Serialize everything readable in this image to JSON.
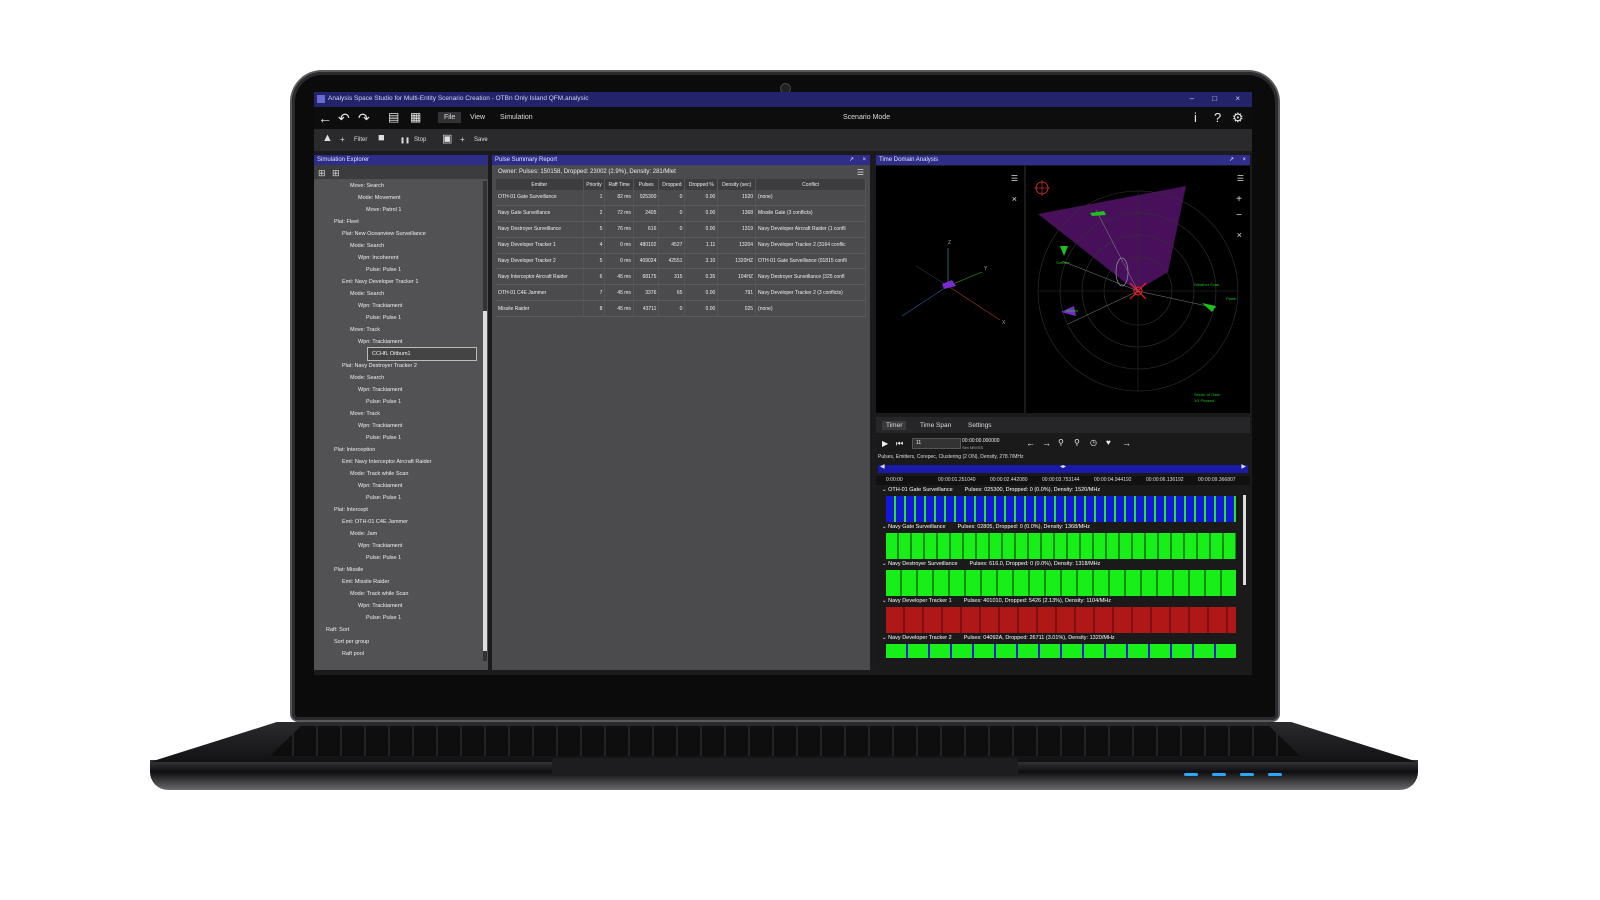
{
  "window": {
    "title": "Analysis Space Studio for Multi-Entity Scenario Creation - OTBn Only Island QFM.analysic",
    "controls": [
      "–",
      "□",
      "×"
    ]
  },
  "menubar": {
    "items": [
      {
        "label": "File",
        "active": true
      },
      {
        "label": "View",
        "active": false
      },
      {
        "label": "Simulation",
        "active": false
      }
    ],
    "mode": "Scenario Mode",
    "right_icons": [
      "info-icon",
      "help-icon",
      "gear-icon"
    ]
  },
  "toolbar": {
    "filter_label": "Filter",
    "stop_label": "Stop",
    "save_label": "Save"
  },
  "explorer": {
    "title": "Simulation Explorer",
    "nodes": [
      {
        "text": "Move:  Search",
        "indent": 4
      },
      {
        "text": "Mode:  Movement",
        "indent": 5
      },
      {
        "text": "Move:  Patrol 1",
        "indent": 6
      },
      {
        "text": "Plat:  Fleet",
        "indent": 2
      },
      {
        "text": "Plat:  New Oceanview Surveillance",
        "indent": 3
      },
      {
        "text": "Mode:  Search",
        "indent": 4
      },
      {
        "text": "Wpn:  Incoherent",
        "indent": 5
      },
      {
        "text": "Pulse:  Pulse 1",
        "indent": 6
      },
      {
        "text": "Emt:  Navy Developer Tracker 1",
        "indent": 3
      },
      {
        "text": "Mode:  Search",
        "indent": 4
      },
      {
        "text": "Wpn:  Trackiament",
        "indent": 5
      },
      {
        "text": "Pulse:  Pulse 1",
        "indent": 6
      },
      {
        "text": "Move:  Track",
        "indent": 4
      },
      {
        "text": "Wpn:  Trackiament",
        "indent": 5
      },
      {
        "text": "CCHfL  Oitbum1",
        "indent": 6,
        "selected": true
      },
      {
        "text": "Plat:  Navy Destroyer Tracker 2",
        "indent": 3
      },
      {
        "text": "Mode:  Search",
        "indent": 4
      },
      {
        "text": "Wpn:  Trackiament",
        "indent": 5
      },
      {
        "text": "Pulse:  Pulse 1",
        "indent": 6
      },
      {
        "text": "Move:  Track",
        "indent": 4
      },
      {
        "text": "Wpn:  Trackiament",
        "indent": 5
      },
      {
        "text": "Pulse:  Pulse 1",
        "indent": 6
      },
      {
        "text": "Plat:  Interception",
        "indent": 2
      },
      {
        "text": "Emt:  Navy Interceptor Aircraft Raider",
        "indent": 3
      },
      {
        "text": "Mode:  Track while Scan",
        "indent": 4
      },
      {
        "text": "Wpn:  Trackiament",
        "indent": 5
      },
      {
        "text": "Pulse:  Pulse 1",
        "indent": 6
      },
      {
        "text": "Plat:  Intercept",
        "indent": 2
      },
      {
        "text": "Emt:  OTH-01 C4E Jammer",
        "indent": 3
      },
      {
        "text": "Mode:  Jam",
        "indent": 4
      },
      {
        "text": "Wpn:  Trackiament",
        "indent": 5
      },
      {
        "text": "Pulse:  Pulse 1",
        "indent": 6
      },
      {
        "text": "Plat:  Missile",
        "indent": 2
      },
      {
        "text": "Emt:  Missile Raider",
        "indent": 3
      },
      {
        "text": "Mode:  Track while Scan",
        "indent": 4
      },
      {
        "text": "Wpn:  Trackiament",
        "indent": 5
      },
      {
        "text": "Pulse:  Pulse 1",
        "indent": 6
      },
      {
        "text": "Raft:  Sort",
        "indent": 1
      },
      {
        "text": "Sort per group",
        "indent": 2
      },
      {
        "text": "Raft pool",
        "indent": 3
      }
    ]
  },
  "pulse_report": {
    "title": "Pulse Summary Report",
    "owner_line": "Owner:  Pulses: 150158, Dropped: 23002 (2.9%), Density: 281/Mlet",
    "columns": [
      "Emitter",
      "Priority",
      "Raff Time",
      "Pulses",
      "Dropped",
      "Dropped %",
      "Density (sec)",
      "Conflict"
    ],
    "rows": [
      [
        "OTH-01 Gate Surveillance",
        "1",
        "82 ms",
        "025300",
        "0",
        "0.00",
        "1520",
        "(none)"
      ],
      [
        "Navy Gate Surveillance",
        "2",
        "72 ms",
        "2405",
        "0",
        "0.00",
        "1368",
        "Missile Gate (3 conflicts)"
      ],
      [
        "Navy Destroyer Surveillance",
        "5",
        "76 ms",
        "616",
        "0",
        "0.00",
        "1319",
        "Navy Developer Aircraft Raider (1 confli"
      ],
      [
        "Navy Developer Tracker 1",
        "4",
        "0 ms",
        "480102",
        "4527",
        "1.11",
        "13204",
        "Navy Developer Tracker 2 (3164 conflic"
      ],
      [
        "Navy Developer Tracker 2",
        "5",
        "0 ms",
        "409024",
        "42551",
        "3.10",
        "1320HZ",
        "OTH-01 Gate Surveillance (01815 confli"
      ],
      [
        "Navy Interceptor Aircraft Raider",
        "6",
        "45 ms",
        "68175",
        "315",
        "0.35",
        "104HZ",
        "Navy Destroyer Surveillance (325 confl"
      ],
      [
        "OTH-01 C4E Jammer",
        "7",
        "45 ms",
        "3376",
        "65",
        "0.00",
        "791",
        "Navy Developer Tracker 2 (3 conflicts)"
      ],
      [
        "Missile Raider",
        "8",
        "45 ms",
        "43711",
        "0",
        "0.00",
        "025",
        "(none)"
      ]
    ]
  },
  "time_domain": {
    "title": "Time Domain Analysis",
    "axis_labels": {
      "z": "Z",
      "y": "Y",
      "x": "X"
    },
    "radar_labels": [
      "Surface",
      "Missile",
      "Weather Scan",
      "Plane",
      "Sector of Gate",
      "1G Phased"
    ],
    "tabs": [
      "Timer",
      "Time Span",
      "Settings"
    ],
    "speed_value": "11",
    "time_readout": "00:00:00.000000",
    "time_sub": "Sim MM:SS",
    "status_line": "Pulses, Emitters, Corepec, Clustering (2 ON), Density, 278.7/MHz",
    "ruler_ticks": [
      "0:00:00",
      "00:00:01.251040",
      "00:00:02.442080",
      "00:00:03.753144",
      "00:00:04.944192",
      "00:00:06.136192",
      "00:00:09.366807"
    ],
    "tracks": [
      {
        "name": "OTH-01 Gate Surveillance",
        "stats": "Pulses: 025300, Dropped: 0 (0.0%), Density: 1520/MHz",
        "colors": [
          "#1616d8",
          "#18ee18"
        ]
      },
      {
        "name": "Navy Gate Surveillance",
        "stats": "Pulses: 02805, Dropped: 0 (0.0%), Density: 1368/MHz",
        "colors": [
          "#18ee18",
          "#0f8a0f"
        ]
      },
      {
        "name": "Navy Destroyer Surveillance",
        "stats": "Pulses: 616.0, Dropped: 0 (0.0%), Density: 1318/MHz",
        "colors": [
          "#18ee18",
          "#0f8a0f"
        ]
      },
      {
        "name": "Navy Developer Tracker 1",
        "stats": "Pulses: 401010, Dropped: 5426 (2.13%), Density: 1104/MHz",
        "colors": [
          "#b01818",
          "#801010"
        ]
      },
      {
        "name": "Navy Developer Tracker 2",
        "stats": "Pulses: 04092A, Dropped: 26711 (3.01%), Density: 1320/MHz",
        "colors": [
          "#18ee18",
          "#1616d8"
        ]
      }
    ]
  }
}
